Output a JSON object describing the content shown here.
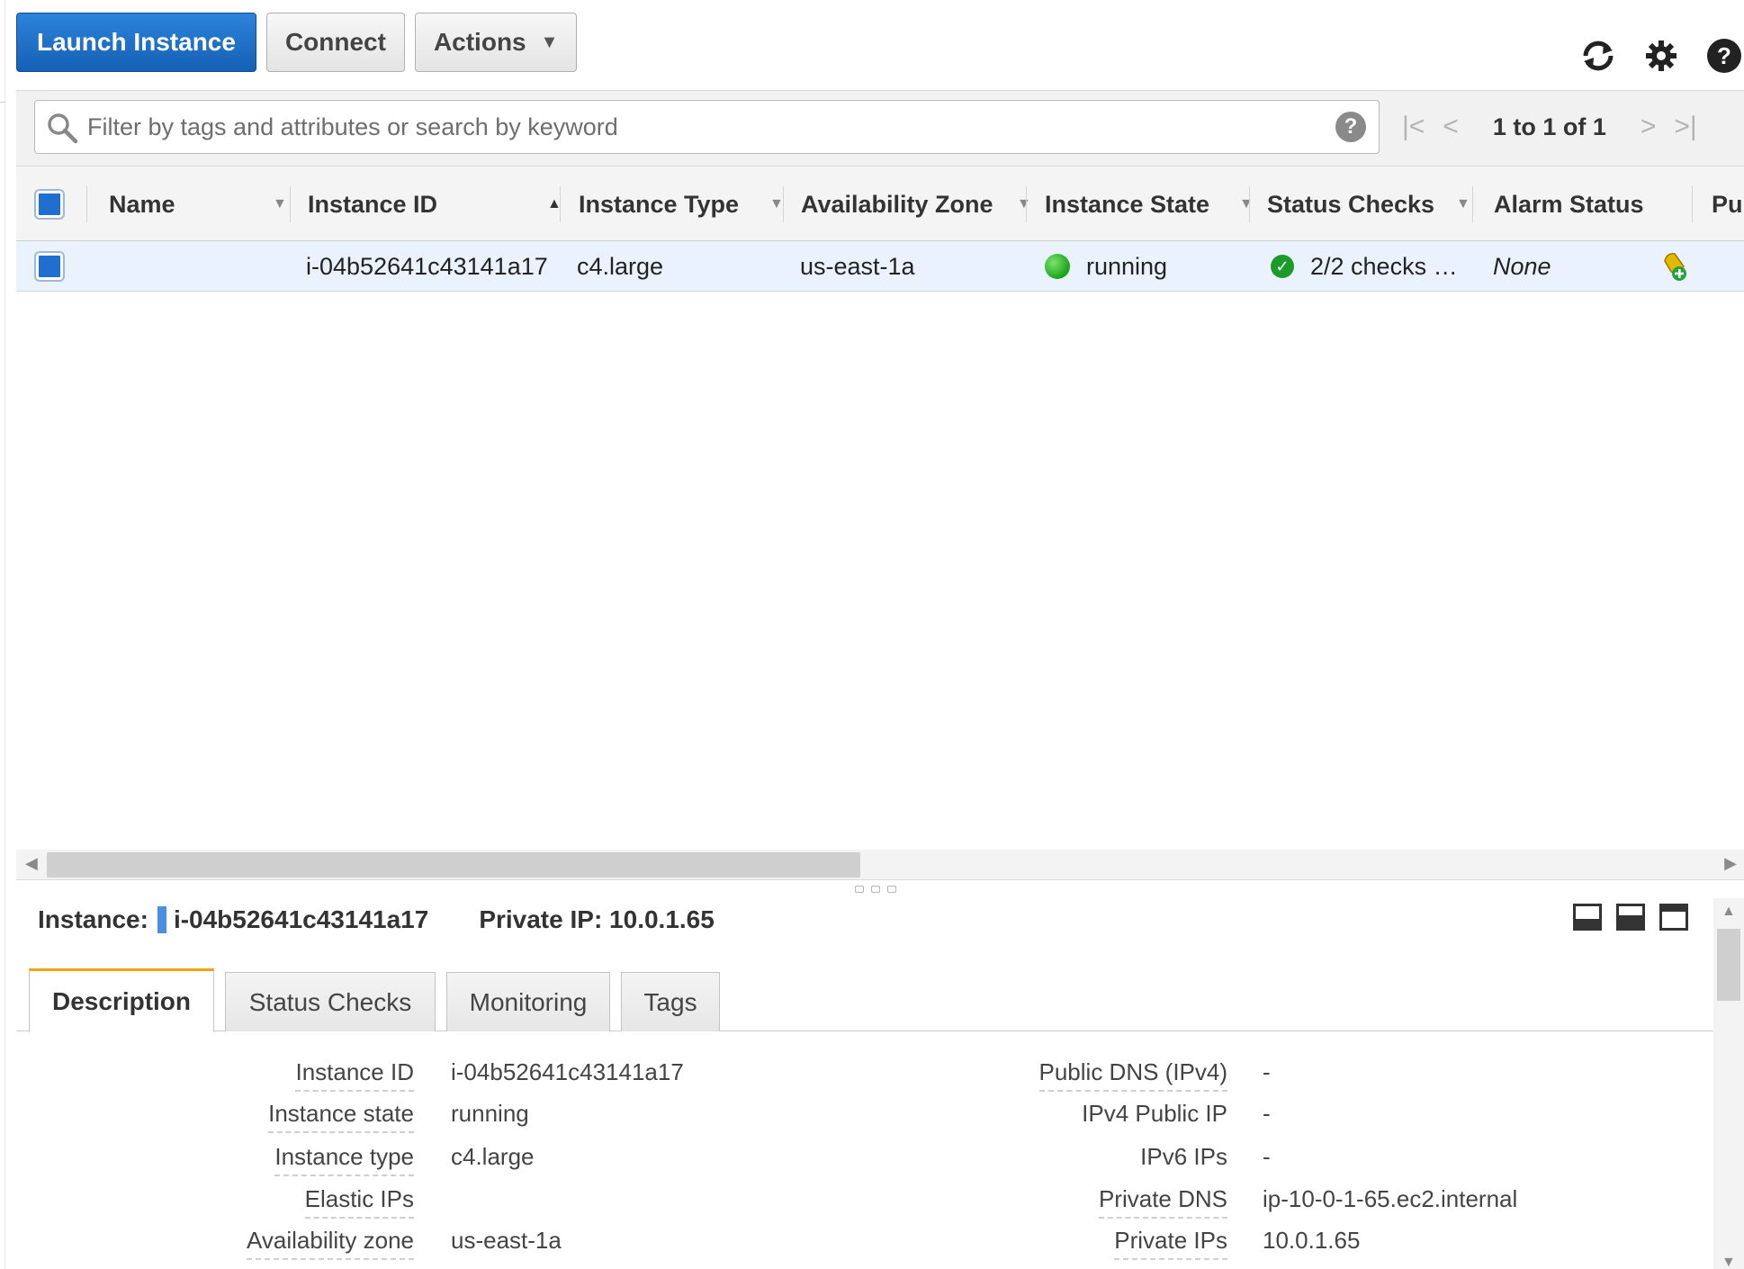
{
  "toolbar": {
    "launch_label": "Launch Instance",
    "connect_label": "Connect",
    "actions_label": "Actions"
  },
  "icons": {
    "refresh": "refresh-icon",
    "settings": "gear-icon",
    "help": "help-icon",
    "help_glyph": "?"
  },
  "filter": {
    "placeholder": "Filter by tags and attributes or search by keyword",
    "help_glyph": "?"
  },
  "pagination": {
    "label": "1 to 1 of 1",
    "first": "|<",
    "prev": "<",
    "next": ">",
    "last": ">|"
  },
  "table": {
    "columns": {
      "name": "Name",
      "instance_id": "Instance ID",
      "instance_type": "Instance Type",
      "availability_zone": "Availability Zone",
      "instance_state": "Instance State",
      "status_checks": "Status Checks",
      "alarm_status": "Alarm Status",
      "public": "Pul"
    },
    "rows": [
      {
        "name": "",
        "instance_id": "i-04b52641c43141a17",
        "instance_type": "c4.large",
        "availability_zone": "us-east-1a",
        "instance_state": "running",
        "status_checks": "2/2 checks …",
        "alarm_status": "None"
      }
    ]
  },
  "detail": {
    "instance_label": "Instance:",
    "instance_id": "i-04b52641c43141a17",
    "private_ip_label": "Private IP: 10.0.1.65",
    "tabs": [
      "Description",
      "Status Checks",
      "Monitoring",
      "Tags"
    ],
    "left": [
      {
        "k": "Instance ID",
        "v": "i-04b52641c43141a17"
      },
      {
        "k": "Instance state",
        "v": "running"
      },
      {
        "k": "Instance type",
        "v": "c4.large"
      },
      {
        "k": "Elastic IPs",
        "v": ""
      },
      {
        "k": "Availability zone",
        "v": "us-east-1a"
      }
    ],
    "right": [
      {
        "k": "Public DNS (IPv4)",
        "v": "-"
      },
      {
        "k": "IPv4 Public IP",
        "v": "-"
      },
      {
        "k": "IPv6 IPs",
        "v": "-"
      },
      {
        "k": "Private DNS",
        "v": "ip-10-0-1-65.ec2.internal"
      },
      {
        "k": "Private IPs",
        "v": "10.0.1.65"
      }
    ]
  },
  "colors": {
    "primary": "#1f6fd0",
    "running": "#1aa31a",
    "tab_accent": "#f0a30a",
    "row_selected": "#eaf3fd"
  }
}
